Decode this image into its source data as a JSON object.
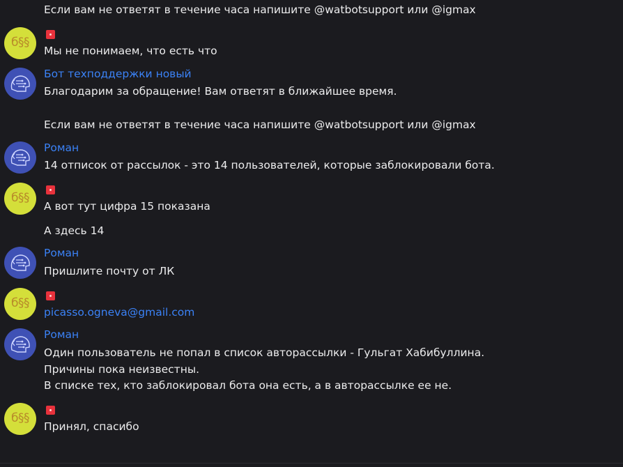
{
  "messages": [
    {
      "avatar": "none",
      "author": "",
      "lines": [
        "Если вам не ответят в течение часа напишите @watbotsupport или @igmax"
      ]
    },
    {
      "avatar": "yellow",
      "avatar_text": "б§§",
      "flag": true,
      "lines": [
        "Мы не понимаем, что есть что"
      ]
    },
    {
      "avatar": "blue",
      "avatar_icon": "robot-head-icon",
      "author": "Бот техподдержки новый",
      "lines": [
        "Благодарим за обращение! Вам ответят в ближайшее время.",
        "",
        "Если вам не ответят в течение часа напишите @watbotsupport или @igmax"
      ]
    },
    {
      "avatar": "blue",
      "avatar_icon": "robot-head-icon",
      "author": "Роман",
      "lines": [
        "14 отписок от рассылок - это 14 пользователей, которые заблокировали бота."
      ]
    },
    {
      "avatar": "yellow",
      "avatar_text": "б§§",
      "flag": true,
      "lines": [
        "А вот тут цифра 15 показана"
      ]
    },
    {
      "avatar": "none",
      "lines": [
        "А здесь 14"
      ]
    },
    {
      "avatar": "blue",
      "avatar_icon": "robot-head-icon",
      "author": "Роман",
      "lines": [
        "Пришлите почту от ЛК"
      ]
    },
    {
      "avatar": "yellow",
      "avatar_text": "б§§",
      "flag": true,
      "lines": [
        "picasso.ogneva@gmail.com"
      ]
    },
    {
      "avatar": "blue",
      "avatar_icon": "robot-head-icon",
      "author": "Роман",
      "lines": [
        "Один пользователь не попал в список авторассылки - Гульгат Хабибуллина.",
        "Причины пока неизвестны.",
        "В списке тех, кто заблокировал бота она есть, а в авторассылке ее не."
      ]
    },
    {
      "avatar": "yellow",
      "avatar_text": "б§§",
      "flag": true,
      "lines": [
        "Принял, спасибо"
      ]
    }
  ],
  "colors": {
    "background": "#1b1b1f",
    "author": "#3b82f6",
    "text": "#ececed",
    "yellow_avatar": "#d4df3a",
    "blue_avatar": "#3f51b5",
    "flag": "#e8323c"
  }
}
